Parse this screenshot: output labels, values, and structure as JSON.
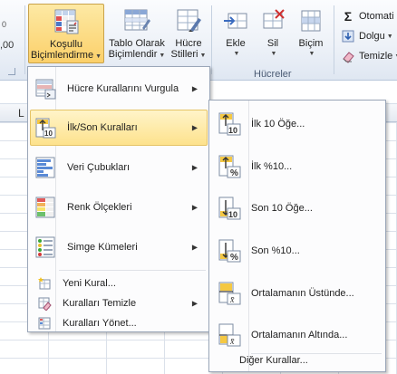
{
  "ribbon": {
    "left_fragment_top": ",00",
    "left_fragment_bottom": "0",
    "conditional_formatting": {
      "line1": "Koşullu",
      "line2": "Biçimlendirme"
    },
    "format_as_table": {
      "line1": "Tablo Olarak",
      "line2": "Biçimlendir"
    },
    "cell_styles": {
      "line1": "Hücre",
      "line2": "Stilleri"
    },
    "insert": "Ekle",
    "delete": "Sil",
    "format": "Biçim",
    "cells_group": "Hücreler",
    "autosum": "Otomati",
    "fill": "Dolgu",
    "clear": "Temizle"
  },
  "sheet": {
    "column_letter": "L"
  },
  "main_menu": {
    "items": [
      {
        "label": "Hücre Kurallarını Vurgula",
        "icon": "highlight-cells-icon"
      },
      {
        "label": "İlk/Son Kuralları",
        "icon": "top-bottom-icon"
      },
      {
        "label": "Veri Çubukları",
        "icon": "data-bars-icon"
      },
      {
        "label": "Renk Ölçekleri",
        "icon": "color-scales-icon"
      },
      {
        "label": "Simge Kümeleri",
        "icon": "icon-sets-icon"
      }
    ],
    "small_items": [
      {
        "label": "Yeni Kural...",
        "icon": "new-rule-icon"
      },
      {
        "label": "Kuralları Temizle",
        "icon": "clear-rules-icon"
      },
      {
        "label": "Kuralları Yönet...",
        "icon": "manage-rules-icon"
      }
    ]
  },
  "sub_menu": {
    "items": [
      {
        "label": "İlk 10 Öğe...",
        "badge": "10"
      },
      {
        "label": "İlk %10...",
        "badge": "%"
      },
      {
        "label": "Son 10 Öğe...",
        "badge": "10"
      },
      {
        "label": "Son %10...",
        "badge": "%"
      },
      {
        "label": "Ortalamanın Üstünde...",
        "badge": "x̄"
      },
      {
        "label": "Ortalamanın Altında...",
        "badge": "x̄"
      }
    ],
    "more_rules": "Diğer Kurallar..."
  },
  "colors": {
    "highlight": "#fde28d",
    "ribbon_bg": "#eef2f8",
    "menu_border": "#9aa6b8"
  }
}
